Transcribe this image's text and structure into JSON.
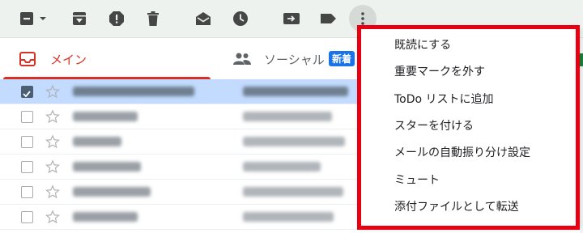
{
  "toolbar": {
    "buttons": [
      {
        "name": "select-checkbox",
        "icon": "checkbox-minus-icon"
      },
      {
        "name": "archive",
        "icon": "archive-icon"
      },
      {
        "name": "report-spam",
        "icon": "spam-icon"
      },
      {
        "name": "delete",
        "icon": "trash-icon"
      },
      {
        "name": "mark-as-read",
        "icon": "open-envelope-icon"
      },
      {
        "name": "snooze",
        "icon": "clock-icon"
      },
      {
        "name": "move-to",
        "icon": "move-to-icon"
      },
      {
        "name": "labels",
        "icon": "label-icon"
      },
      {
        "name": "more",
        "icon": "more-vert-icon"
      }
    ]
  },
  "tabs": {
    "main_label": "メイン",
    "social_label": "ソーシャル",
    "new_badge": "新着"
  },
  "menu": {
    "items": [
      "既読にする",
      "重要マークを外す",
      "ToDo リストに追加",
      "スターを付ける",
      "メールの自動振り分け設定",
      "ミュート",
      "添付ファイルとして転送"
    ]
  },
  "emails": [
    {
      "selected": true,
      "checked": true
    },
    {
      "selected": false,
      "checked": false
    },
    {
      "selected": false,
      "checked": false
    },
    {
      "selected": false,
      "checked": false
    },
    {
      "selected": false,
      "checked": false
    },
    {
      "selected": false,
      "checked": false
    }
  ],
  "colors": {
    "accent_red": "#d93025",
    "highlight_frame": "#e60012",
    "badge_blue": "#1a73e8",
    "selected_row": "#c2dbff"
  }
}
